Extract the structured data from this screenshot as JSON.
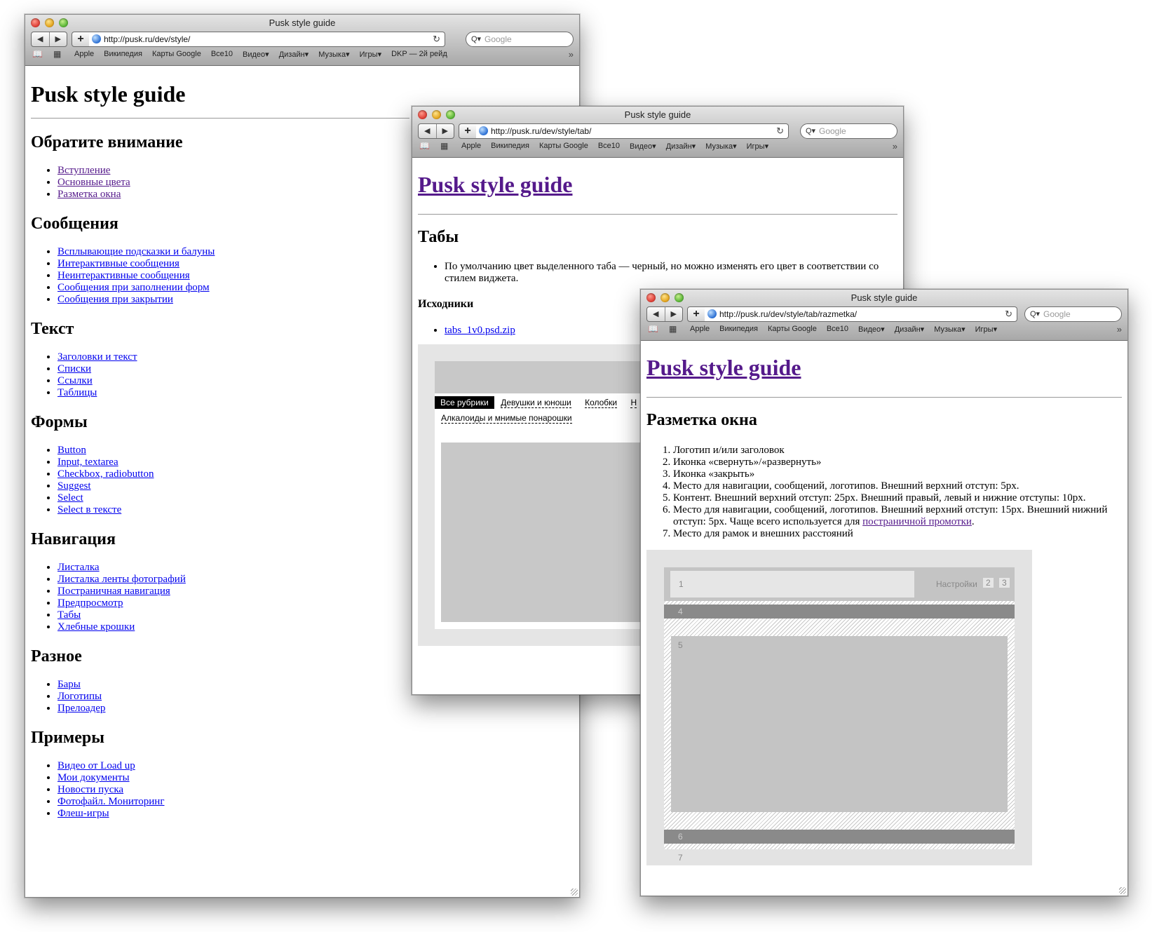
{
  "browser": {
    "back_icon": "◀",
    "forward_icon": "▶",
    "add_icon": "+",
    "reload_icon": "↻",
    "search_icon": "Q▾",
    "search_placeholder": "Google",
    "bookmarks_icon": "📖",
    "topsites_icon": "▦",
    "more_icon": "»"
  },
  "win1": {
    "title": "Pusk style guide",
    "url": "http://pusk.ru/dev/style/",
    "bookmarks": [
      "Apple",
      "Википедия",
      "Карты Google",
      "Все10",
      "Видео▾",
      "Дизайн▾",
      "Музыка▾",
      "Игры▾",
      "DKP — 2й рейд"
    ],
    "heading": "Pusk style guide",
    "sections": [
      {
        "title": "Обратите внимание",
        "items": [
          "Вступление",
          "Основные цвета",
          "Разметка окна"
        ]
      },
      {
        "title": "Сообщения",
        "items": [
          "Всплывающие подсказки и балуны",
          "Интерактивные сообщения",
          "Неинтерактивные сообщения",
          "Сообщения при заполнении форм",
          "Сообщения при закрытии"
        ]
      },
      {
        "title": "Текст",
        "items": [
          "Заголовки и текст",
          "Списки",
          "Ссылки",
          "Таблицы"
        ]
      },
      {
        "title": "Формы",
        "items": [
          "Button",
          "Input, textarea",
          "Checkbox, radiobutton",
          "Suggest",
          "Select",
          "Select в тексте"
        ]
      },
      {
        "title": "Навигация",
        "items": [
          "Листалка",
          "Листалка ленты фотографий",
          "Постраничная навигация",
          "Предпросмотр",
          "Табы",
          "Хлебные крошки"
        ]
      },
      {
        "title": "Разное",
        "items": [
          "Бары",
          "Логотипы",
          "Прелоадер"
        ]
      },
      {
        "title": "Примеры",
        "items": [
          "Видео от Load up",
          "Мои документы",
          "Новости пуска",
          "Фотофайл. Мониторинг",
          "Флеш-игры"
        ]
      }
    ]
  },
  "win2": {
    "title": "Pusk style guide",
    "url": "http://pusk.ru/dev/style/tab/",
    "bookmarks": [
      "Apple",
      "Википедия",
      "Карты Google",
      "Все10",
      "Видео▾",
      "Дизайн▾",
      "Музыка▾",
      "Игры▾"
    ],
    "heading": "Pusk style guide",
    "section_title": "Табы",
    "note": "По умолчанию цвет выделенного таба — черный, но можно изменять его цвет в соответствии со стилем виджета.",
    "sources_title": "Исходники",
    "file_link": "tabs_1v0.psd.zip",
    "demo_tabs": [
      "Все рубрики",
      "Девушки и юноши",
      "Колобки",
      "Н"
    ],
    "demo_tab2": "Алкалоиды и мнимые понарошки"
  },
  "win3": {
    "title": "Pusk style guide",
    "url": "http://pusk.ru/dev/style/tab/razmetka/",
    "bookmarks": [
      "Apple",
      "Википедия",
      "Карты Google",
      "Все10",
      "Видео▾",
      "Дизайн▾",
      "Музыка▾",
      "Игры▾"
    ],
    "heading": "Pusk style guide",
    "section_title": "Разметка окна",
    "items": [
      "Логотип и/или заголовок",
      "Иконка «свернуть»/«развернуть»",
      "Иконка «закрыть»",
      "Место для навигации, сообщений, логотипов. Внешний верхний отступ: 5px.",
      "Контент. Внешний верхний отступ: 25px. Внешний правый, левый и нижние отступы: 10px."
    ],
    "item6_before": "Место для навигации, сообщений, логотипов. Внешний верхний отступ: 15px. Внешний нижний отступ: 5px. Чаще всего используется для ",
    "item6_link": "постраничной промотки",
    "item6_after": ".",
    "item7": "Место для рамок и внешних расстояний",
    "diagram": {
      "label1": "1",
      "settings": "Настройки",
      "label2": "2",
      "label3": "3",
      "label4": "4",
      "label5": "5",
      "label6": "6",
      "label7": "7"
    }
  }
}
